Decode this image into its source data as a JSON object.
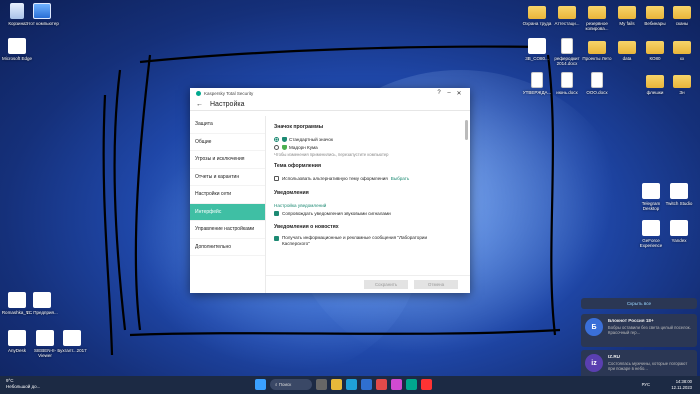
{
  "desktop": {
    "left_icons": [
      {
        "label": "Корзина",
        "kind": "bin"
      },
      {
        "label": "Этот компьютер",
        "kind": "pc"
      },
      {
        "label": "Microsoft Edge",
        "kind": "app"
      },
      {
        "label": "Romashka_V...",
        "kind": "app"
      },
      {
        "label": "1С Предприя...",
        "kind": "app"
      },
      {
        "label": "AnyDesk",
        "kind": "app"
      },
      {
        "label": "SIEBEN-II-Viewer",
        "kind": "app"
      },
      {
        "label": "Бухгалт...2017",
        "kind": "app"
      }
    ],
    "right_icons": [
      {
        "label": "Охрана труда",
        "kind": "folder"
      },
      {
        "label": "Аттестаци...",
        "kind": "folder"
      },
      {
        "label": "резервное копирова...",
        "kind": "folder"
      },
      {
        "label": "My fails",
        "kind": "folder"
      },
      {
        "label": "Вебинары",
        "kind": "folder"
      },
      {
        "label": "сканы",
        "kind": "folder"
      },
      {
        "label": "3B_CO80...",
        "kind": "app"
      },
      {
        "label": "реферодкит 2014.docx",
        "kind": "doc"
      },
      {
        "label": "Проекты Лето",
        "kind": "folder"
      },
      {
        "label": "data",
        "kind": "folder"
      },
      {
        "label": "КО80",
        "kind": "folder"
      },
      {
        "label": "xx",
        "kind": "folder"
      },
      {
        "label": "УТВЕРЖДА...",
        "kind": "doc"
      },
      {
        "label": "июнь.docx",
        "kind": "doc"
      },
      {
        "label": "ООО.docx",
        "kind": "doc"
      },
      {
        "label": "флешки",
        "kind": "folder"
      },
      {
        "label": "Зн",
        "kind": "folder"
      },
      {
        "label": "Telegram Desktop",
        "kind": "app"
      },
      {
        "label": "Twitch Studio",
        "kind": "app"
      },
      {
        "label": "GeForce Experience",
        "kind": "app"
      },
      {
        "label": "Yandex",
        "kind": "app"
      }
    ]
  },
  "window": {
    "app_title": "Kaspersky Total Security",
    "page_title": "Настройка",
    "nav": [
      {
        "label": "Защита",
        "active": false
      },
      {
        "label": "Общие",
        "active": false
      },
      {
        "label": "Угрозы и исключения",
        "active": false
      },
      {
        "label": "Отчеты и карантин",
        "active": false
      },
      {
        "label": "Настройки сети",
        "active": false
      },
      {
        "label": "Интерфейс",
        "active": true
      },
      {
        "label": "Управление настройками",
        "active": false
      },
      {
        "label": "Дополнительно",
        "active": false
      }
    ],
    "sections": {
      "icon_title": "Значок программы",
      "icon_opt1": "Стандартный значок",
      "icon_opt2": "Мадорн Кума",
      "icon_note": "Чтобы изменения применились, перезапустите компьютер",
      "theme_title": "Тема оформления",
      "theme_chk": "Использовать альтернативную тему оформления",
      "theme_link": "Выбрать",
      "notif_title": "Уведомления",
      "notif_link": "Настройка уведомлений",
      "notif_chk": "Сопровождать уведомления звуковыми сигналами",
      "news_title": "Уведомления о новостях",
      "news_chk": "Получать информационные и рекламные сообщения \"Лаборатории Касперского\""
    },
    "save_label": "Сохранить",
    "cancel_label": "Отмена"
  },
  "notifications": {
    "hide_label": "Скрыть все",
    "cards": [
      {
        "title": "Блокнот Россия 18+",
        "body": "Бобры оставили без света целый поселок. Красочный гер...",
        "color": "#3a6fd8",
        "letter": "Б"
      },
      {
        "title": "IZ.RU",
        "body": "Состоялась мужчины, которые погорают при пожаре в небо...",
        "color": "#5a3fb0",
        "letter": "iz"
      }
    ]
  },
  "taskbar": {
    "weather_temp": "9°С",
    "weather_text": "Небольшой до...",
    "search_label": "Поиск",
    "lang": "РУС",
    "time": "14:38:00",
    "date": "12.11.2023"
  }
}
